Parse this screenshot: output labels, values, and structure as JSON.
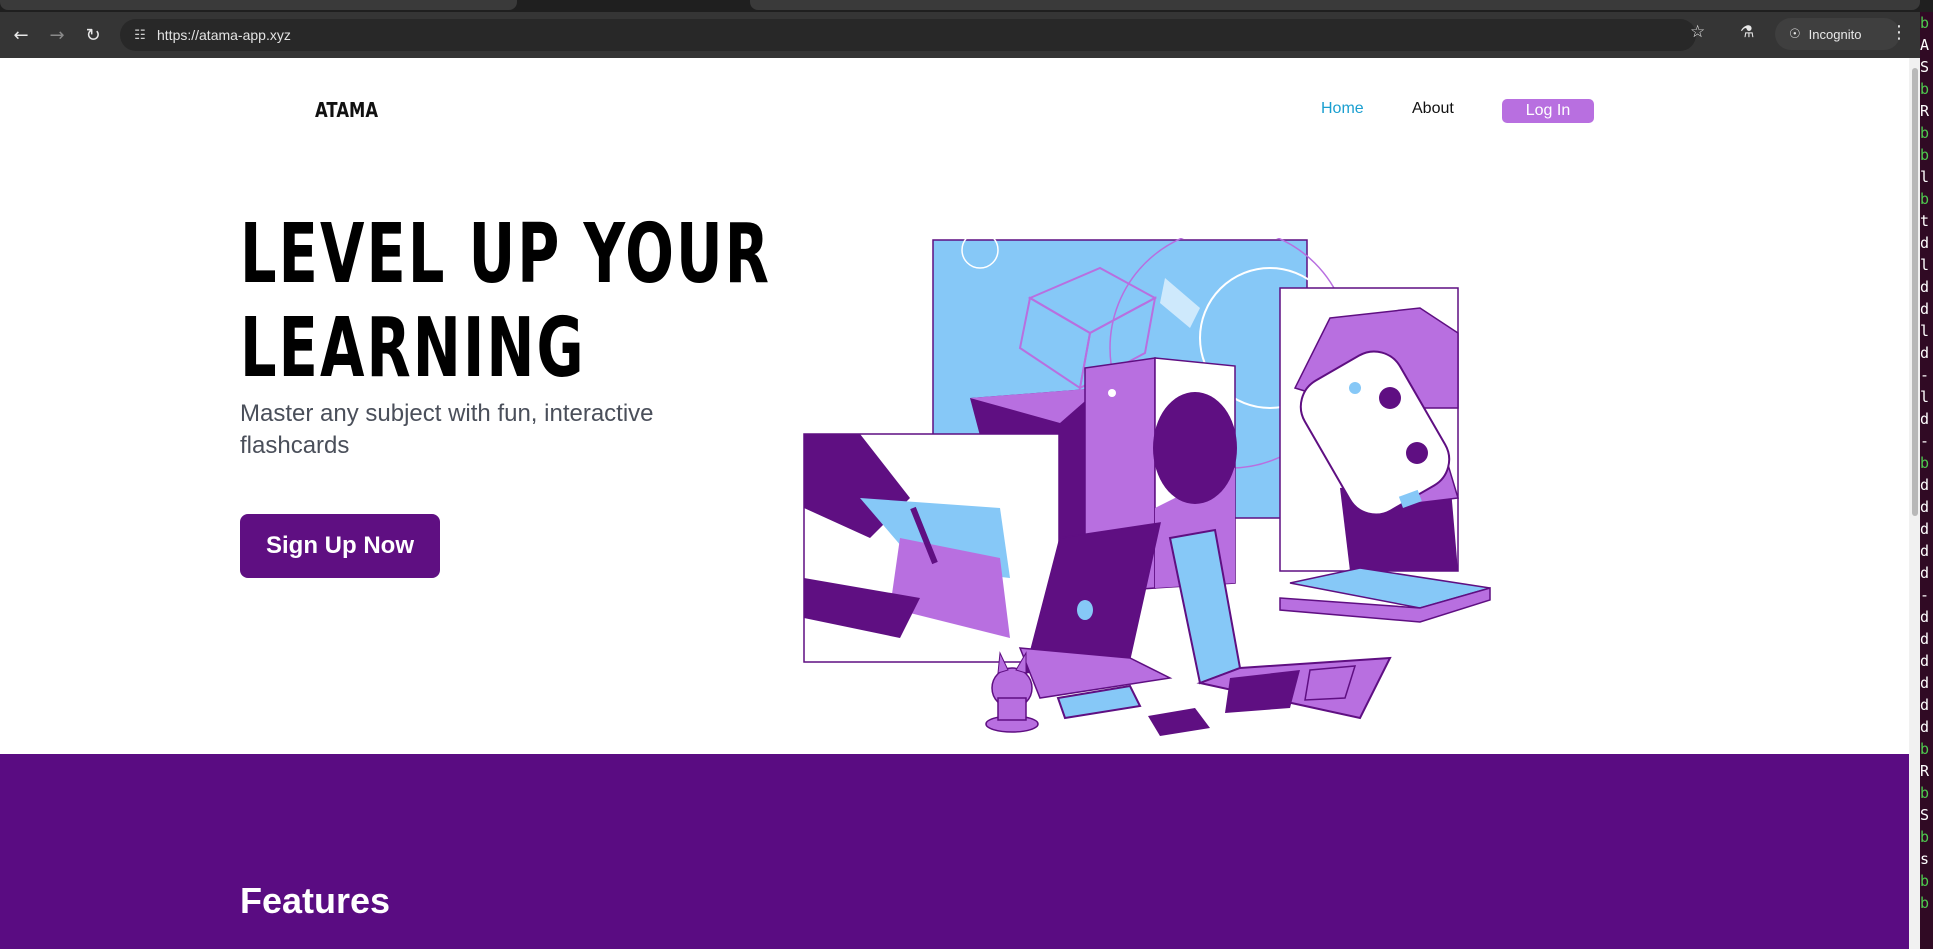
{
  "browser": {
    "url": "https://atama-app.xyz",
    "incognito_label": "Incognito",
    "back_icon": "←",
    "forward_icon": "→",
    "reload_icon": "↻",
    "site_info_icon": "☷",
    "star_icon": "☆",
    "labs_icon": "⚗",
    "incognito_icon": "☉",
    "menu_icon": "⋮"
  },
  "terminal": {
    "lines": [
      "b",
      "A",
      "S",
      "b",
      "R",
      "b",
      "b",
      "l",
      "b",
      "t",
      "d",
      "l",
      "d",
      "d",
      "l",
      "d",
      "-",
      "l",
      "d",
      "-",
      "b",
      "d",
      "d",
      "d",
      "d",
      "d",
      "-",
      "d",
      "d",
      "d",
      "d",
      "d",
      "d",
      "b",
      "R",
      "b",
      "S",
      "b",
      "s",
      "b",
      "b"
    ]
  },
  "nav": {
    "brand": "ATAMA",
    "home": "Home",
    "about": "About",
    "login": "Log In"
  },
  "hero": {
    "headline_line1": "LEVEL UP YOUR",
    "headline_line2": "LEARNING",
    "subtitle": "Master any subject with fun, interactive flashcards",
    "cta": "Sign Up Now"
  },
  "features": {
    "title": "Features"
  },
  "colors": {
    "brand_purple": "#5f0f82",
    "login_purple": "#b86fe0",
    "link_blue": "#1a9fd0",
    "art_light_purple": "#b86fe0",
    "art_dark_purple": "#5f0f82",
    "art_light_blue": "#86c8f7"
  }
}
